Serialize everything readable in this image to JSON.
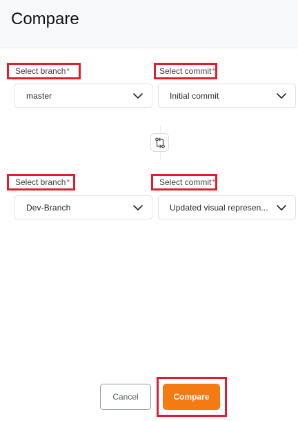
{
  "header": {
    "title": "Compare"
  },
  "source": {
    "branch_label": "Select branch",
    "commit_label": "Select commit",
    "required_marker": "*",
    "branch_value": "master",
    "commit_value": "Initial commit"
  },
  "target": {
    "branch_label": "Select branch",
    "commit_label": "Select commit",
    "required_marker": "*",
    "branch_value": "Dev-Branch",
    "commit_value": "Updated visual represen..."
  },
  "icons": {
    "dropdown": "chevron-down-icon",
    "swap": "git-compare-icon"
  },
  "actions": {
    "cancel_label": "Cancel",
    "compare_label": "Compare"
  },
  "colors": {
    "accent": "#f47a12",
    "highlight_outline": "#e01e2a",
    "required": "#e84a4a"
  }
}
